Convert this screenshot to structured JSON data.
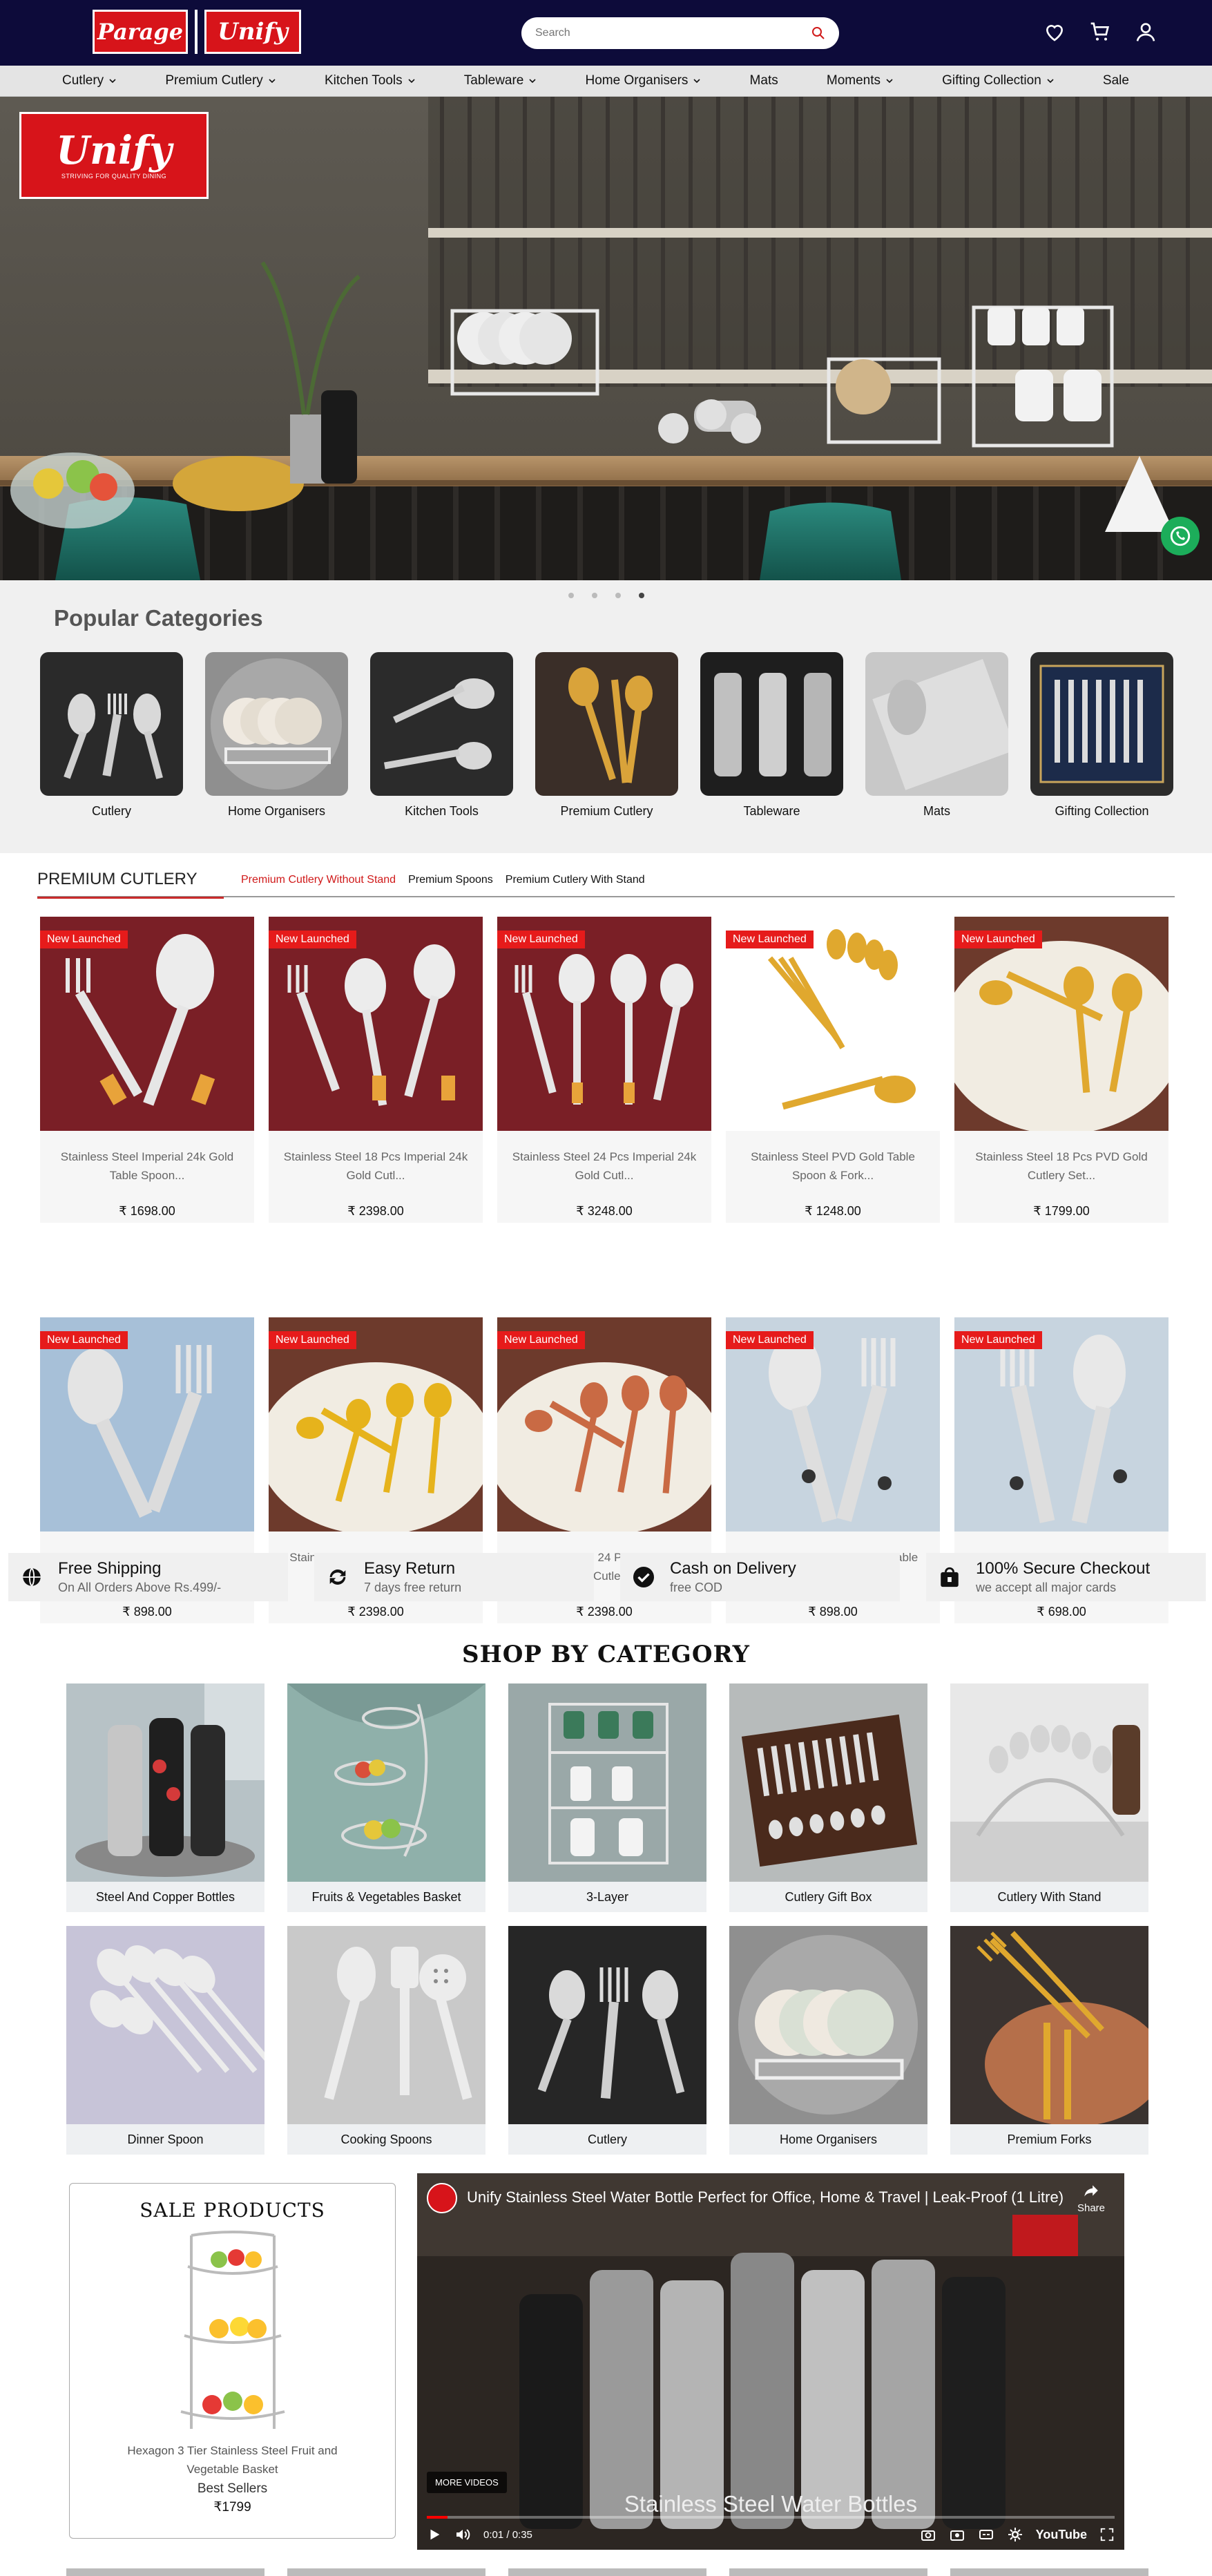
{
  "header": {
    "logo_parage": "Parage",
    "logo_unify": "Unify",
    "search_placeholder": "Search",
    "icons": [
      "heart-icon",
      "cart-icon",
      "user-icon"
    ]
  },
  "nav": [
    {
      "label": "Cutlery",
      "dropdown": true
    },
    {
      "label": "Premium Cutlery",
      "dropdown": true
    },
    {
      "label": "Kitchen Tools",
      "dropdown": true
    },
    {
      "label": "Tableware",
      "dropdown": true
    },
    {
      "label": "Home Organisers",
      "dropdown": true
    },
    {
      "label": "Mats",
      "dropdown": false
    },
    {
      "label": "Moments",
      "dropdown": true
    },
    {
      "label": "Gifting Collection",
      "dropdown": true
    },
    {
      "label": "Sale",
      "dropdown": false
    }
  ],
  "hero": {
    "logo_text": "Unify",
    "logo_tagline": "STRIVING FOR QUALITY DINING",
    "slide_count": 4,
    "active_slide": 4
  },
  "popular": {
    "title": "Popular Categories",
    "items": [
      "Cutlery",
      "Home Organisers",
      "Kitchen Tools",
      "Premium Cutlery",
      "Tableware",
      "Mats",
      "Gifting Collection"
    ]
  },
  "premium": {
    "title": "PREMIUM CUTLERY",
    "tabs": [
      "Premium Cutlery Without Stand",
      "Premium Spoons",
      "Premium Cutlery With Stand"
    ],
    "active_tab": 0,
    "badge": "New Launched",
    "products": [
      {
        "name": "Stainless Steel Imperial 24k Gold Table Spoon...",
        "price": "₹ 1698.00"
      },
      {
        "name": "Stainless Steel 18 Pcs Imperial 24k Gold Cutl...",
        "price": "₹ 2398.00"
      },
      {
        "name": "Stainless Steel 24 Pcs Imperial 24k Gold Cutl...",
        "price": "₹ 3248.00"
      },
      {
        "name": "Stainless Steel PVD Gold Table Spoon & Fork...",
        "price": "₹ 1248.00"
      },
      {
        "name": "Stainless Steel 18 Pcs PVD Gold Cutlery Set...",
        "price": "₹ 1799.00"
      },
      {
        "name": "Stainless Steel Imperial Table Spoon & Fork...",
        "price": "₹ 898.00"
      },
      {
        "name": "Stainless Steel 24 Pcs PVD Gold Cutlery Set...",
        "price": "₹ 2398.00"
      },
      {
        "name": "Stainless Steel 24 Pcs PVD Rose Gold Cutlery ...",
        "price": "₹ 2398.00"
      },
      {
        "name": "Stainless Steel Moonpress Table Spoon & Fork...",
        "price": "₹ 898.00"
      },
      {
        "name": "Stainless Steel Moonpress Dinner Spoon & Fork...",
        "price": "₹ 698.00"
      }
    ]
  },
  "features": [
    {
      "title": "Free Shipping",
      "sub": "On All Orders Above Rs.499/-",
      "icon": "globe-icon"
    },
    {
      "title": "Easy Return",
      "sub": "7 days free return",
      "icon": "refresh-icon"
    },
    {
      "title": "Cash on Delivery",
      "sub": "free COD",
      "icon": "check-circle-icon"
    },
    {
      "title": "100% Secure Checkout",
      "sub": "we accept all major cards",
      "icon": "lock-bag-icon"
    }
  ],
  "shop_by_category": {
    "title": "SHOP BY CATEGORY",
    "items": [
      "Steel And Copper Bottles",
      "Fruits & Vegetables Basket",
      "3-Layer",
      "Cutlery Gift Box",
      "Cutlery With Stand",
      "Dinner Spoon",
      "Cooking Spoons",
      "Cutlery",
      "Home Organisers",
      "Premium Forks"
    ]
  },
  "sale": {
    "title": "SALE PRODUCTS",
    "product_name": "Hexagon 3 Tier Stainless Steel Fruit and Vegetable Basket",
    "tag": "Best Sellers",
    "price": "₹1799"
  },
  "video": {
    "title": "Unify Stainless Steel Water Bottle Perfect for Office, Home & Travel | Leak-Proof (1 Litre)",
    "share": "Share",
    "more_videos": "MORE VIDEOS",
    "caption": "Stainless Steel Water Bottles",
    "time": "0:01 / 0:35",
    "brand": "YouTube",
    "watermark": "Unify",
    "progress": 0.03
  }
}
